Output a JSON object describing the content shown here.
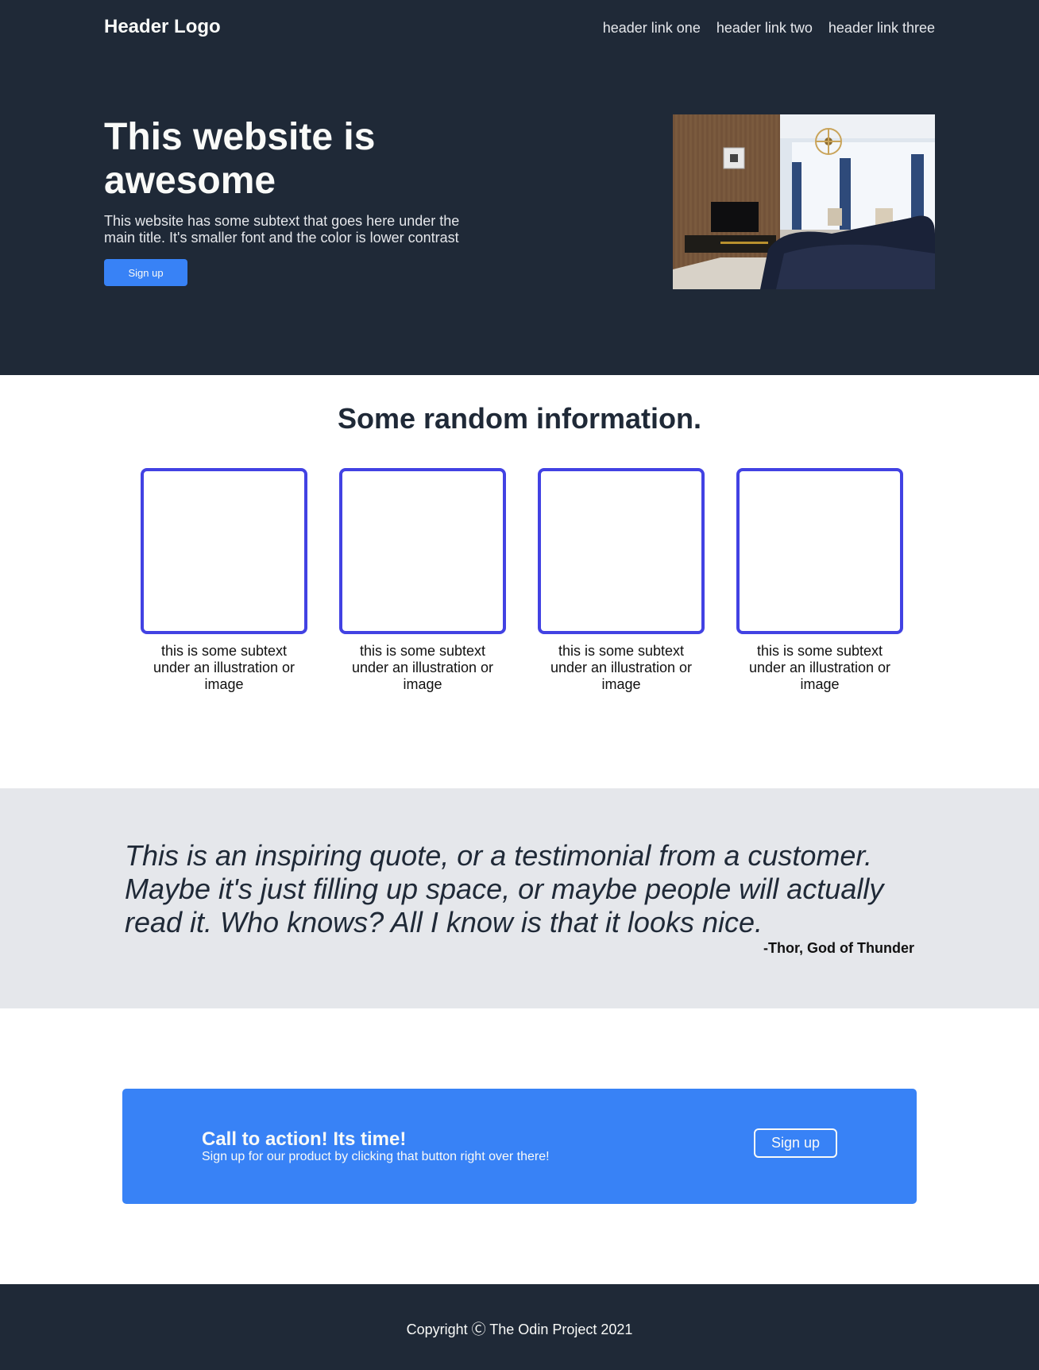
{
  "header": {
    "logo": "Header Logo",
    "links": [
      "header link one",
      "header link two",
      "header link three"
    ]
  },
  "hero": {
    "title": "This website is awesome",
    "subtext": "This website has some subtext that goes here under the main title. It's smaller font and the color is lower contrast",
    "button_label": "Sign up",
    "image": "living-room-photo"
  },
  "info": {
    "title": "Some random information.",
    "cards": [
      {
        "text": "this is some subtext under an illustration or image"
      },
      {
        "text": "this is some subtext under an illustration or image"
      },
      {
        "text": "this is some subtext under an illustration or image"
      },
      {
        "text": "this is some subtext under an illustration or image"
      }
    ]
  },
  "quote": {
    "text": "This is an inspiring quote, or a testimonial from a customer. Maybe it's just filling up space, or maybe people will actually read it. Who knows? All I know is that it looks nice.",
    "author": "-Thor, God of Thunder"
  },
  "cta": {
    "title": "Call to action! Its time!",
    "subtext": "Sign up for our product by clicking that button right over there!",
    "button_label": "Sign up"
  },
  "footer": {
    "copyright": "Copyright Ⓒ The Odin Project 2021"
  },
  "colors": {
    "dark_bg": "#1f2937",
    "accent_blue": "#3882f6",
    "card_border": "#4242e3",
    "quote_bg": "#e5e7eb",
    "light_text": "#f9faf8"
  }
}
